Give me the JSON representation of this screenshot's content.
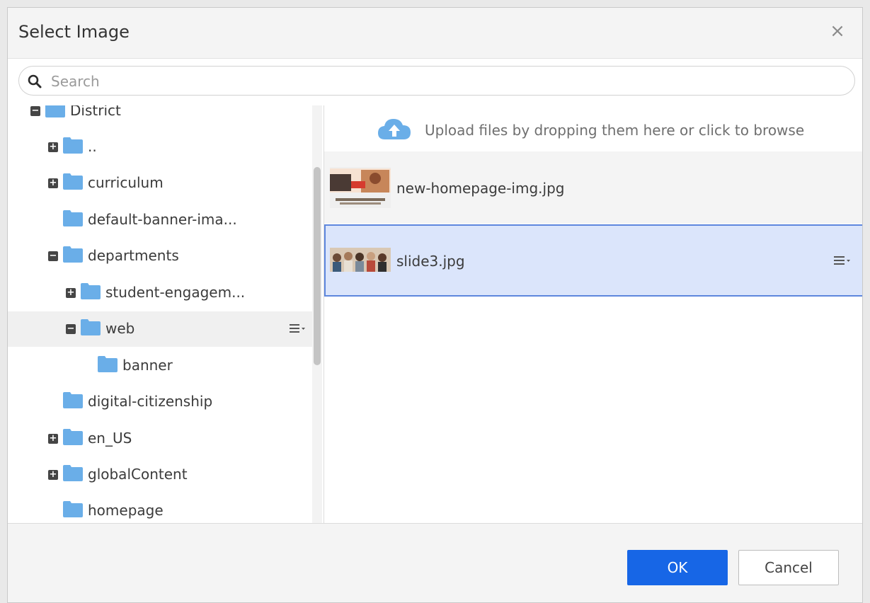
{
  "dialog": {
    "title": "Select Image",
    "close_glyph": "×"
  },
  "search": {
    "placeholder": "Search",
    "value": ""
  },
  "tree": {
    "items": [
      {
        "label": "District",
        "expander": "collapse"
      },
      {
        "label": "..",
        "expander": "expand"
      },
      {
        "label": "curriculum",
        "expander": "expand"
      },
      {
        "label": "default-banner-ima...",
        "expander": "none"
      },
      {
        "label": "departments",
        "expander": "collapse"
      },
      {
        "label": "student-engagem...",
        "expander": "expand"
      },
      {
        "label": "web",
        "expander": "collapse",
        "hovered": true
      },
      {
        "label": "banner",
        "expander": "none"
      },
      {
        "label": "digital-citizenship",
        "expander": "none"
      },
      {
        "label": "en_US",
        "expander": "expand"
      },
      {
        "label": "globalContent",
        "expander": "expand"
      },
      {
        "label": "homepage",
        "expander": "none"
      }
    ]
  },
  "upload": {
    "text": "Upload files by dropping them here or click to browse"
  },
  "files": [
    {
      "name": "new-homepage-img.jpg",
      "selected": false
    },
    {
      "name": "slide3.jpg",
      "selected": true
    }
  ],
  "footer": {
    "ok_label": "OK",
    "cancel_label": "Cancel"
  },
  "colors": {
    "accent": "#1766e6",
    "folder": "#6aaee8",
    "selected_row_bg": "#dbe5fb",
    "selected_row_border": "#5d86dd"
  },
  "icons": {
    "search": "search-icon",
    "close": "close-icon",
    "folder": "folder-icon",
    "expand": "plus-square-icon",
    "collapse": "minus-square-icon",
    "upload": "cloud-upload-icon",
    "row_menu": "menu-dropdown-icon"
  }
}
